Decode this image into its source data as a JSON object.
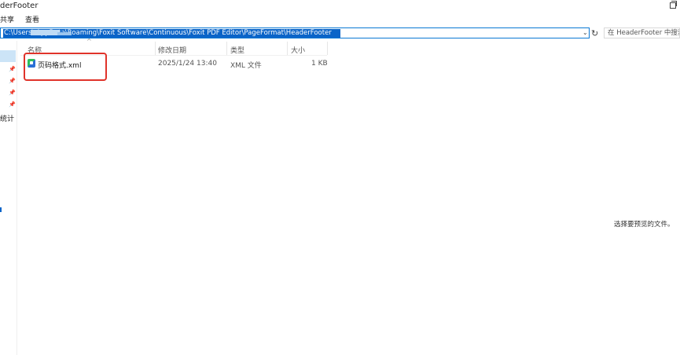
{
  "window": {
    "title": "derFooter"
  },
  "menu": [
    {
      "label": "共享"
    },
    {
      "label": "查看"
    }
  ],
  "address": {
    "path": "C:\\Users\\ AppData\\Roaming\\Foxit Software\\Continuous\\Foxit PDF Editor\\PageFormat\\HeaderFooter"
  },
  "search": {
    "placeholder": "在 HeaderFooter 中搜索"
  },
  "nav": {
    "partial_label": "统计"
  },
  "columns": {
    "name": "名称",
    "modified": "修改日期",
    "type": "类型",
    "size": "大小"
  },
  "files": [
    {
      "name": "页码格式.xml",
      "modified": "2025/1/24 13:40",
      "type": "XML 文件",
      "size": "1 KB"
    }
  ],
  "preview": {
    "message": "选择要预览的文件。"
  },
  "colors": {
    "accent": "#0a64c8",
    "highlight": "#e0332a"
  }
}
